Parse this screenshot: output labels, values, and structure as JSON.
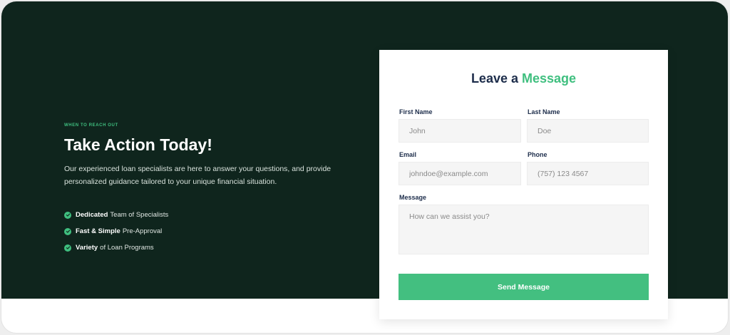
{
  "hero": {
    "eyebrow": "WHEN TO REACH OUT",
    "title": "Take Action Today!",
    "description": "Our experienced loan specialists are here to answer your questions, and provide personalized guidance tailored to your unique financial situation.",
    "features": [
      {
        "bold": "Dedicated",
        "rest": "Team of Specialists"
      },
      {
        "bold": "Fast & Simple",
        "rest": "Pre-Approval"
      },
      {
        "bold": "Variety",
        "rest": "of Loan Programs"
      }
    ]
  },
  "form": {
    "title_part1": "Leave a",
    "title_part2": "Message",
    "first_name": {
      "label": "First Name",
      "placeholder": "John"
    },
    "last_name": {
      "label": "Last Name",
      "placeholder": "Doe"
    },
    "email": {
      "label": "Email",
      "placeholder": "johndoe@example.com"
    },
    "phone": {
      "label": "Phone",
      "placeholder": "(757) 123 4567"
    },
    "message": {
      "label": "Message",
      "placeholder": "How can we assist you?"
    },
    "submit_label": "Send Message"
  },
  "colors": {
    "background_dark": "#0f251d",
    "accent_green": "#3fbf7f",
    "navy": "#1c2c4a"
  },
  "icons": {
    "feature_bullet": "check-circle-icon"
  }
}
